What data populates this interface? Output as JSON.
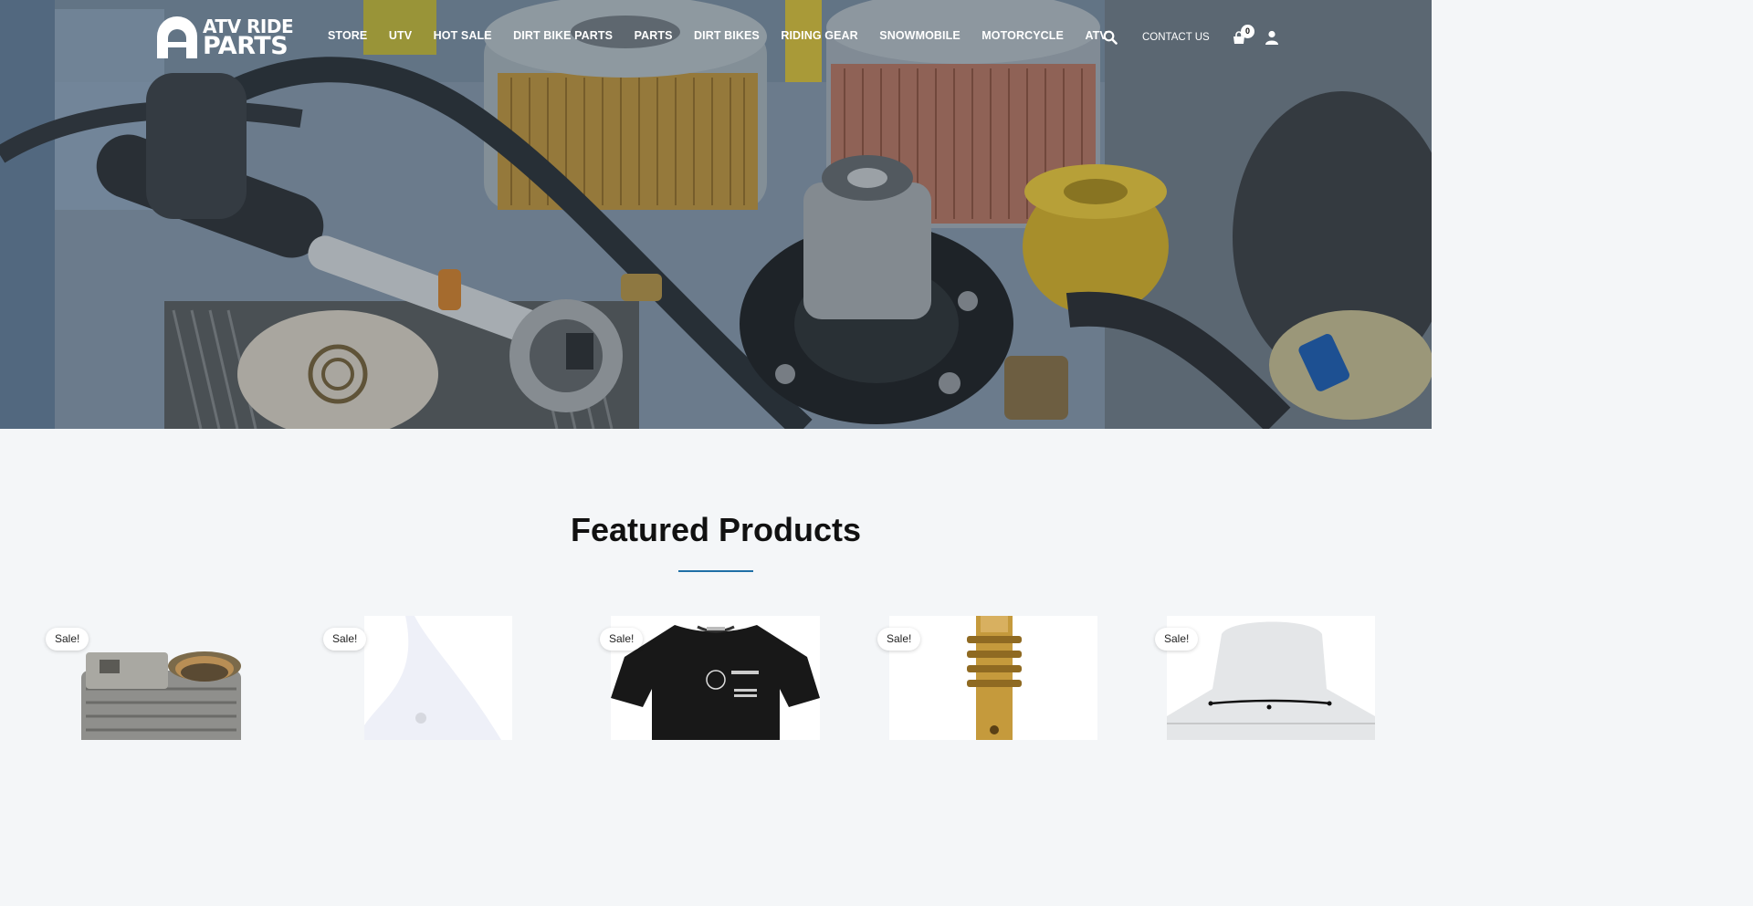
{
  "header": {
    "logo": {
      "line1": "ATV RIDE",
      "line2": "PARTS"
    },
    "nav": [
      "STORE",
      "UTV",
      "HOT SALE",
      "DIRT BIKE PARTS",
      "PARTS",
      "DIRT BIKES",
      "RIDING GEAR",
      "SNOWMOBILE",
      "MOTORCYCLE",
      "ATV"
    ],
    "contact_label": "CONTACT US",
    "cart_count": "0",
    "icons": {
      "search": "search-icon",
      "cart": "cart-icon",
      "account": "user-icon"
    }
  },
  "featured": {
    "title": "Featured Products",
    "accent_color": "#1f6fa6",
    "products": [
      {
        "badge": "Sale!",
        "image": "engine-cylinder"
      },
      {
        "badge": "Sale!",
        "image": "white-plastic-fender"
      },
      {
        "badge": "Sale!",
        "image": "black-t-shirt"
      },
      {
        "badge": "Sale!",
        "image": "brass-carburetor-jet"
      },
      {
        "badge": "Sale!",
        "image": "clear-windshield"
      }
    ]
  }
}
